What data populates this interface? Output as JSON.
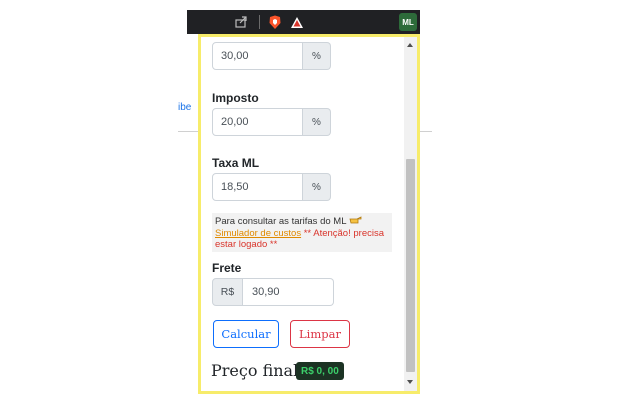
{
  "toolbar": {
    "icons": [
      "share-icon",
      "brave-shield-icon",
      "triangle-icon"
    ],
    "extension_badge": "ML"
  },
  "background": {
    "link_fragment": "ibe"
  },
  "fields": [
    {
      "label": "",
      "value": "30,00",
      "suffix": "%"
    },
    {
      "label": "Imposto",
      "value": "20,00",
      "suffix": "%"
    },
    {
      "label": "Taxa ML",
      "value": "18,50",
      "suffix": "%"
    }
  ],
  "notice": {
    "text": "Para consultar as tarifas do ML",
    "icon": "pointing-hand-icon",
    "link": "Simulador de custos",
    "warning": "** Atenção! precisa estar logado **"
  },
  "frete": {
    "label": "Frete",
    "prefix": "R$",
    "value": "30,90"
  },
  "buttons": {
    "calculate": "Calcular",
    "clear": "Limpar"
  },
  "result": {
    "label": "Preço final",
    "value": "R$ 0, 00"
  },
  "colors": {
    "popup_border": "#f7ec6a",
    "primary": "#0d6efd",
    "danger": "#dc3545",
    "notice_link": "#e08a00",
    "result_bg": "#1c3324",
    "result_text": "#3ccf6a"
  }
}
